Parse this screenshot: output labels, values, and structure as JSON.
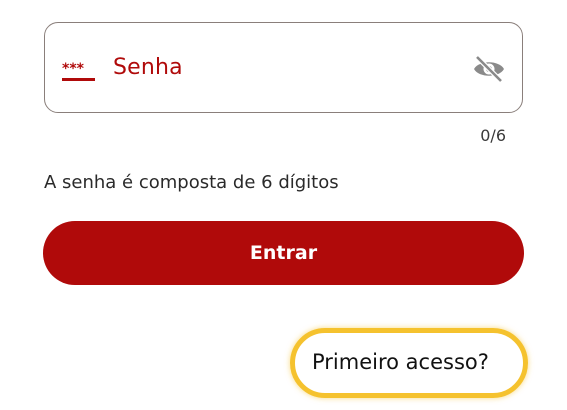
{
  "password_field": {
    "label": "Senha",
    "icon": "password-stars-icon",
    "toggle_icon": "eye-off-icon"
  },
  "counter": "0/6",
  "helper_text": "A senha é composta de 6 dígitos",
  "enter_button": {
    "label": "Entrar"
  },
  "first_access_link": {
    "label": "Primeiro acesso?"
  },
  "colors": {
    "accent": "#b00a0a",
    "border": "#8a7f7b",
    "highlight": "#f5c22e"
  }
}
